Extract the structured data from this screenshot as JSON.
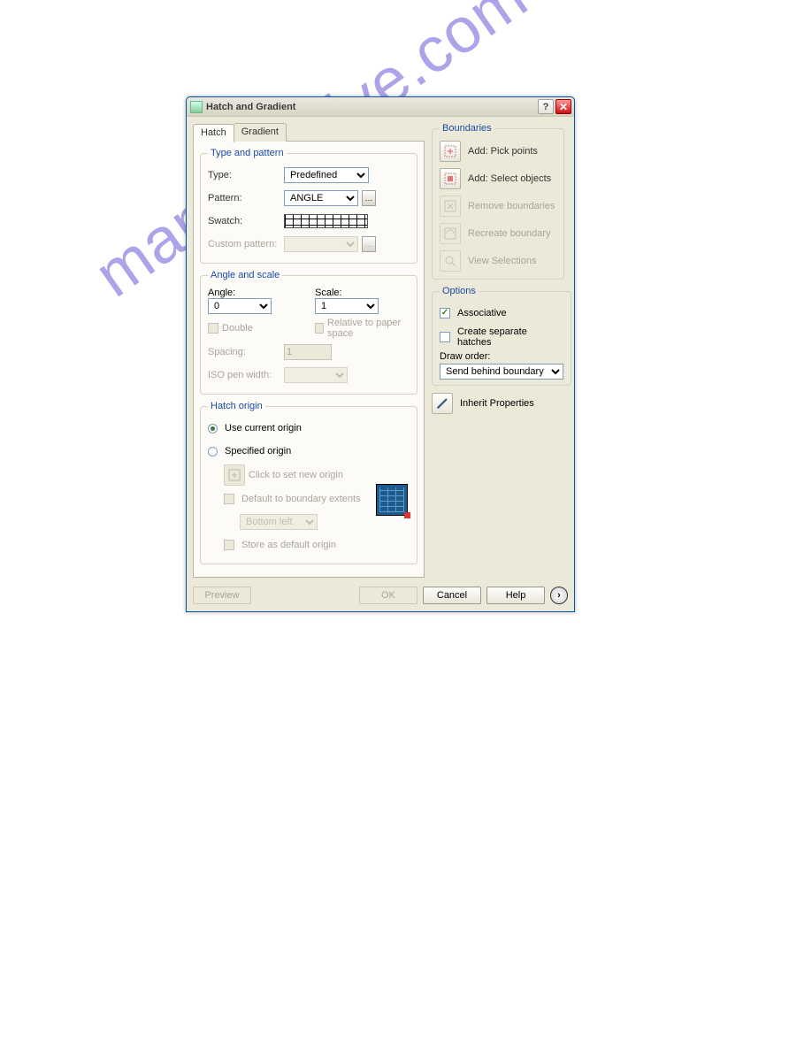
{
  "window": {
    "title": "Hatch and Gradient"
  },
  "tabs": {
    "hatch": "Hatch",
    "gradient": "Gradient"
  },
  "typePattern": {
    "legend": "Type and pattern",
    "type_label": "Type:",
    "type_value": "Predefined",
    "pattern_label": "Pattern:",
    "pattern_value": "ANGLE",
    "swatch_label": "Swatch:",
    "custom_label": "Custom pattern:"
  },
  "angleScale": {
    "legend": "Angle and scale",
    "angle_label": "Angle:",
    "angle_value": "0",
    "scale_label": "Scale:",
    "scale_value": "1",
    "double": "Double",
    "relative": "Relative to paper space",
    "spacing_label": "Spacing:",
    "spacing_value": "1",
    "iso_label": "ISO pen width:"
  },
  "hatchOrigin": {
    "legend": "Hatch origin",
    "use_current": "Use current origin",
    "specified": "Specified origin",
    "click_new": "Click to set new origin",
    "default_extents": "Default to boundary extents",
    "extents_value": "Bottom left",
    "store_default": "Store as default origin"
  },
  "boundaries": {
    "legend": "Boundaries",
    "pick": "Add: Pick points",
    "select": "Add: Select objects",
    "remove": "Remove boundaries",
    "recreate": "Recreate boundary",
    "view": "View Selections"
  },
  "options": {
    "legend": "Options",
    "associative": "Associative",
    "separate": "Create separate hatches",
    "draw_order_label": "Draw order:",
    "draw_order_value": "Send behind boundary"
  },
  "inherit": "Inherit Properties",
  "buttons": {
    "preview": "Preview",
    "ok": "OK",
    "cancel": "Cancel",
    "help": "Help"
  },
  "watermark": "manualshive.com"
}
